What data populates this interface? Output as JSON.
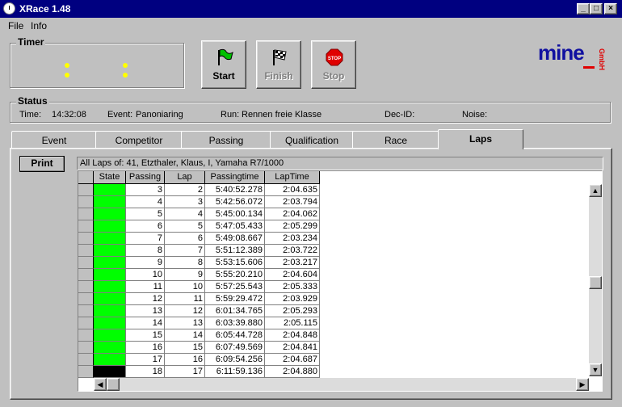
{
  "window": {
    "title": "XRace 1.48"
  },
  "menu": [
    {
      "label": "File",
      "accel": "F"
    },
    {
      "label": "Info",
      "accel": "I"
    }
  ],
  "timer": {
    "title": "Timer"
  },
  "toolbar": {
    "start": "Start",
    "finish": "Finish",
    "stop": "Stop",
    "stop_sign": "STOP"
  },
  "logo": {
    "text": "mine",
    "sub": "GmbH"
  },
  "status": {
    "title": "Status",
    "time_label": "Time:",
    "time": "14:32:08",
    "event_label": "Event:",
    "event": "Panoniaring",
    "run_label": "Run:",
    "run": "Rennen freie Klasse",
    "decid_label": "Dec-ID:",
    "noise_label": "Noise:"
  },
  "tabs": [
    "Event",
    "Competitor",
    "Passing",
    "Qualification",
    "Race",
    "Laps"
  ],
  "active_tab": "Laps",
  "print_label": "Print",
  "table": {
    "caption": "All Laps of: 41, Etzthaler, Klaus, I, Yamaha R7/1000",
    "columns": [
      "State",
      "Passing",
      "Lap",
      "Passingtime",
      "LapTime"
    ],
    "rows": [
      {
        "state": "green",
        "passing": "3",
        "lap": "2",
        "time": "5:40:52.278",
        "laptime": "2:04.635"
      },
      {
        "state": "green",
        "passing": "4",
        "lap": "3",
        "time": "5:42:56.072",
        "laptime": "2:03.794"
      },
      {
        "state": "green",
        "passing": "5",
        "lap": "4",
        "time": "5:45:00.134",
        "laptime": "2:04.062"
      },
      {
        "state": "green",
        "passing": "6",
        "lap": "5",
        "time": "5:47:05.433",
        "laptime": "2:05.299"
      },
      {
        "state": "green",
        "passing": "7",
        "lap": "6",
        "time": "5:49:08.667",
        "laptime": "2:03.234"
      },
      {
        "state": "green",
        "passing": "8",
        "lap": "7",
        "time": "5:51:12.389",
        "laptime": "2:03.722"
      },
      {
        "state": "green",
        "passing": "9",
        "lap": "8",
        "time": "5:53:15.606",
        "laptime": "2:03.217"
      },
      {
        "state": "green",
        "passing": "10",
        "lap": "9",
        "time": "5:55:20.210",
        "laptime": "2:04.604"
      },
      {
        "state": "green",
        "passing": "11",
        "lap": "10",
        "time": "5:57:25.543",
        "laptime": "2:05.333"
      },
      {
        "state": "green",
        "passing": "12",
        "lap": "11",
        "time": "5:59:29.472",
        "laptime": "2:03.929"
      },
      {
        "state": "green",
        "passing": "13",
        "lap": "12",
        "time": "6:01:34.765",
        "laptime": "2:05.293"
      },
      {
        "state": "green",
        "passing": "14",
        "lap": "13",
        "time": "6:03:39.880",
        "laptime": "2:05.115"
      },
      {
        "state": "green",
        "passing": "15",
        "lap": "14",
        "time": "6:05:44.728",
        "laptime": "2:04.848"
      },
      {
        "state": "green",
        "passing": "16",
        "lap": "15",
        "time": "6:07:49.569",
        "laptime": "2:04.841"
      },
      {
        "state": "green",
        "passing": "17",
        "lap": "16",
        "time": "6:09:54.256",
        "laptime": "2:04.687"
      },
      {
        "state": "black",
        "passing": "18",
        "lap": "17",
        "time": "6:11:59.136",
        "laptime": "2:04.880"
      }
    ]
  },
  "colors": {
    "titlebar": "#000080",
    "state_green": "#00ff00",
    "state_black": "#000000",
    "timer_digits": "#ffff00",
    "logo_blue": "#1010a0",
    "logo_red": "#e00000"
  }
}
